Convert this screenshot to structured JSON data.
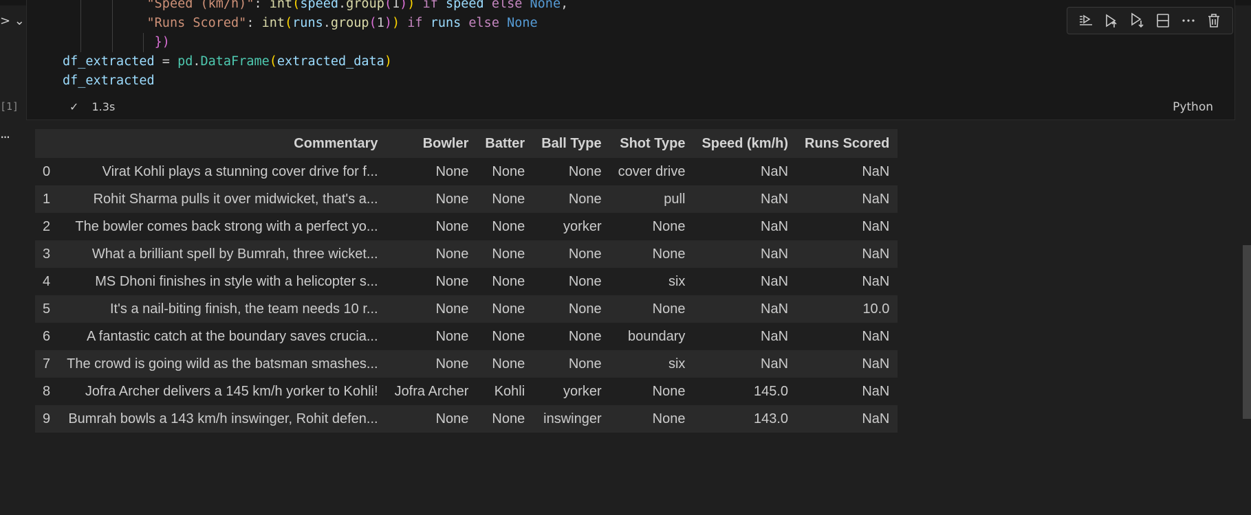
{
  "gutter": {
    "execution_count": "[1]"
  },
  "code_lines": {
    "l1_key": "\"Speed (km/h)\"",
    "l1_fn": "int",
    "l1_var": "speed",
    "l1_meth": "group",
    "l1_num": "1",
    "l1_if": "if",
    "l1_cond": "speed",
    "l1_else": "else",
    "l1_none": "None",
    "l2_key": "\"Runs Scored\"",
    "l2_fn": "int",
    "l2_var": "runs",
    "l2_meth": "group",
    "l2_num": "1",
    "l2_if": "if",
    "l2_cond": "runs",
    "l2_else": "else",
    "l2_none": "None",
    "l3_close": "})",
    "l4_var": "df_extracted",
    "l4_mod": "pd",
    "l4_cls": "DataFrame",
    "l4_arg": "extracted_data",
    "l5_var": "df_extracted"
  },
  "status": {
    "check": "✓",
    "duration": "1.3s",
    "language": "Python"
  },
  "toolbar_icons": [
    "run-by-line-icon",
    "execute-above-icon",
    "execute-below-icon",
    "split-cell-icon",
    "more-actions-icon",
    "delete-icon"
  ],
  "table": {
    "columns": [
      "Commentary",
      "Bowler",
      "Batter",
      "Ball Type",
      "Shot Type",
      "Speed (km/h)",
      "Runs Scored"
    ],
    "rows": [
      [
        "0",
        "Virat Kohli plays a stunning cover drive for f...",
        "None",
        "None",
        "None",
        "cover drive",
        "NaN",
        "NaN"
      ],
      [
        "1",
        "Rohit Sharma pulls it over midwicket, that's a...",
        "None",
        "None",
        "None",
        "pull",
        "NaN",
        "NaN"
      ],
      [
        "2",
        "The bowler comes back strong with a perfect yo...",
        "None",
        "None",
        "yorker",
        "None",
        "NaN",
        "NaN"
      ],
      [
        "3",
        "What a brilliant spell by Bumrah, three wicket...",
        "None",
        "None",
        "None",
        "None",
        "NaN",
        "NaN"
      ],
      [
        "4",
        "MS Dhoni finishes in style with a helicopter s...",
        "None",
        "None",
        "None",
        "six",
        "NaN",
        "NaN"
      ],
      [
        "5",
        "It's a nail-biting finish, the team needs 10 r...",
        "None",
        "None",
        "None",
        "None",
        "NaN",
        "10.0"
      ],
      [
        "6",
        "A fantastic catch at the boundary saves crucia...",
        "None",
        "None",
        "None",
        "boundary",
        "NaN",
        "NaN"
      ],
      [
        "7",
        "The crowd is going wild as the batsman smashes...",
        "None",
        "None",
        "None",
        "six",
        "NaN",
        "NaN"
      ],
      [
        "8",
        "Jofra Archer delivers a 145 km/h yorker to Kohli!",
        "Jofra Archer",
        "Kohli",
        "yorker",
        "None",
        "145.0",
        "NaN"
      ],
      [
        "9",
        "Bumrah bowls a 143 km/h inswinger, Rohit defen...",
        "None",
        "None",
        "inswinger",
        "None",
        "143.0",
        "NaN"
      ]
    ]
  },
  "colors": {
    "background": "#1f1f1f",
    "cell_background": "#181818",
    "string": "#ce9178",
    "keyword": "#c586c0",
    "function": "#dcdcaa",
    "variable": "#9cdcfe",
    "constant": "#569cd6",
    "class": "#4ec9b0"
  }
}
